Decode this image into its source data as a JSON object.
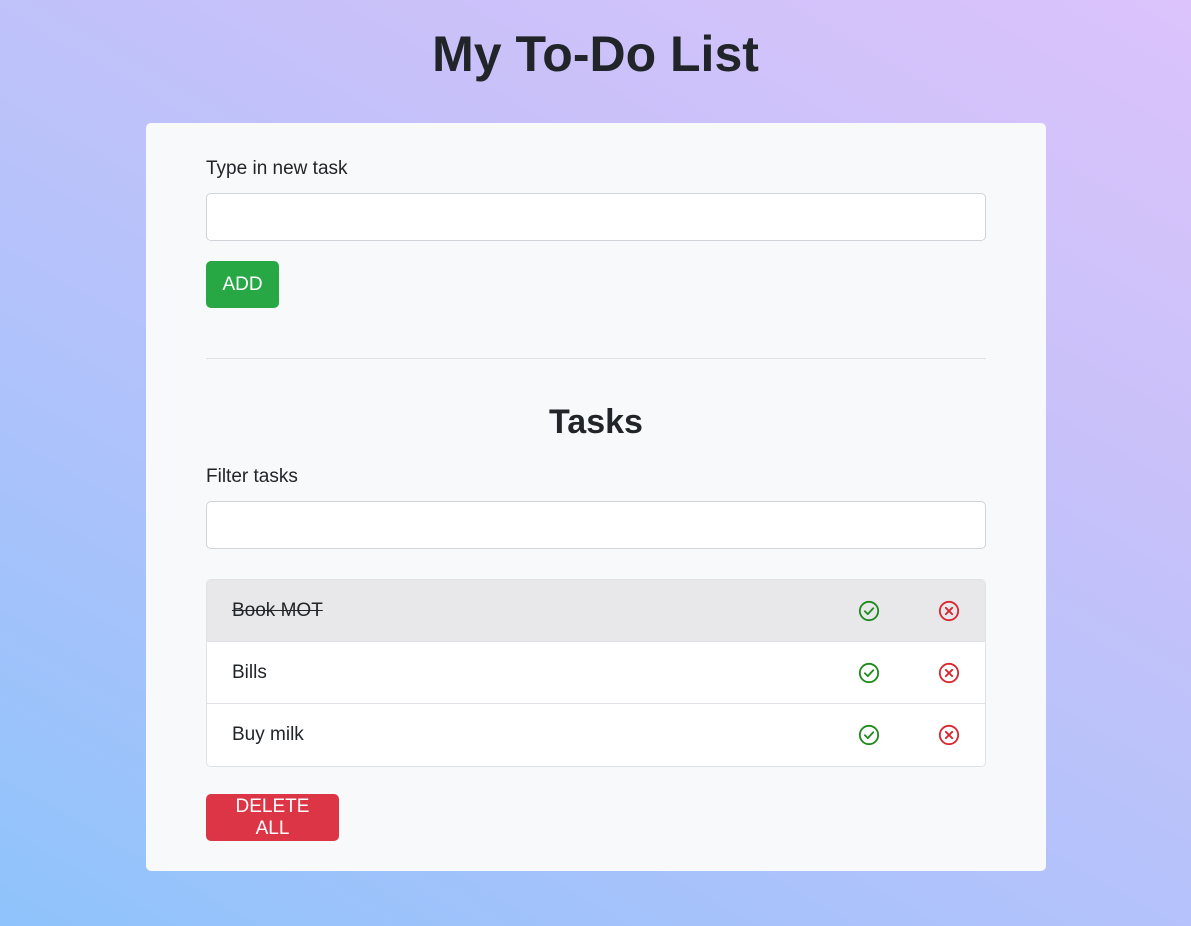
{
  "app": {
    "title": "My To-Do List"
  },
  "new_task": {
    "label": "Type in new task",
    "value": "",
    "placeholder": ""
  },
  "add_button": {
    "label": "ADD"
  },
  "tasks_section": {
    "title": "Tasks",
    "filter_label": "Filter tasks",
    "filter_value": "",
    "filter_placeholder": ""
  },
  "tasks": [
    {
      "text": "Book MOT",
      "completed": true,
      "complete_icon": "check-circle-icon",
      "delete_icon": "x-circle-icon"
    },
    {
      "text": "Bills",
      "completed": false,
      "complete_icon": "check-circle-icon",
      "delete_icon": "x-circle-icon"
    },
    {
      "text": "Buy milk",
      "completed": false,
      "complete_icon": "check-circle-icon",
      "delete_icon": "x-circle-icon"
    }
  ],
  "delete_all_button": {
    "label": "DELETE ALL"
  },
  "colors": {
    "add_button": "#28a745",
    "delete_all_button": "#dc3545",
    "complete_icon": "#1e8a1e",
    "delete_icon": "#d9262f",
    "completed_row": "#e8e8ea"
  }
}
